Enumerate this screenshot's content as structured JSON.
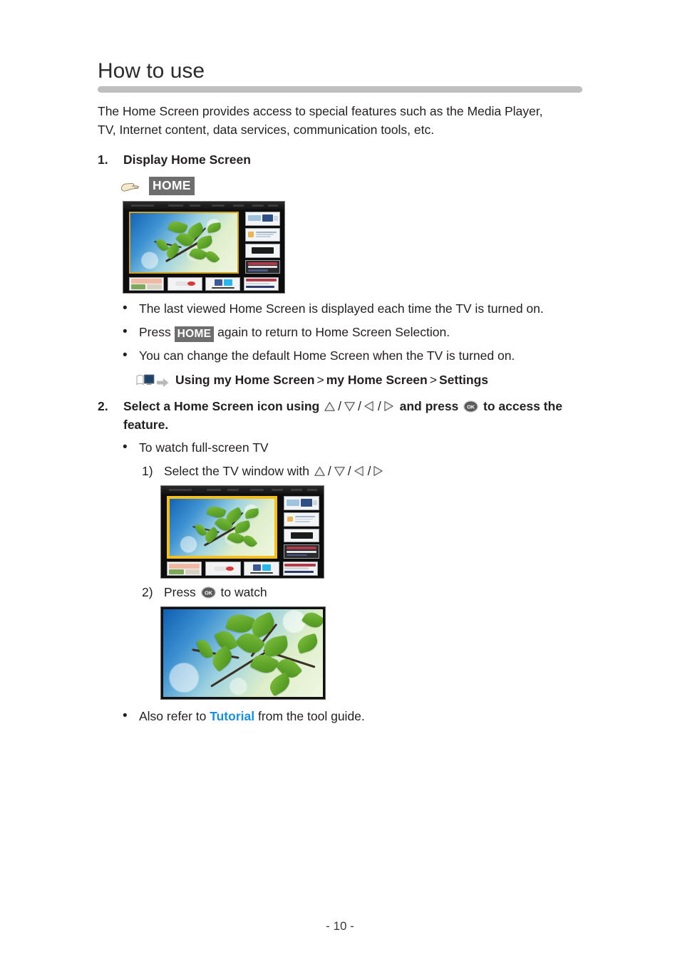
{
  "document": {
    "title": "How to use",
    "page_number": "- 10 -"
  },
  "intro": "The Home Screen provides access to special features such as the Media Player, TV, Internet content, data services, communication tools, etc.",
  "steps": [
    {
      "number": "1.",
      "heading": "Display Home Screen",
      "key_label": "HOME",
      "hand_icon": "pointing-hand-icon",
      "image_caption": "home-screen-tv-thumbnail",
      "bullets": [
        {
          "before": "The last viewed Home Screen is displayed each time the TV is turned on.",
          "key": "",
          "after": ""
        },
        {
          "before": "Press ",
          "key": "HOME",
          "after": " again to return to Home Screen Selection."
        },
        {
          "before": "You can change the default Home Screen when the TV is turned on.",
          "key": "",
          "after": ""
        }
      ],
      "path": {
        "book_icon": "manual-book-icon",
        "arrow_icon": "arrow-right-icon",
        "parts": [
          "Using my Home Screen",
          "my Home Screen",
          "Settings"
        ],
        "separator": ">"
      }
    },
    {
      "number": "2.",
      "heading_part1": "Select a Home Screen icon using",
      "heading_part2": "and press",
      "heading_part3": "to access the feature.",
      "arrow_icons": [
        "triangle-up-icon",
        "triangle-down-icon",
        "triangle-left-icon",
        "triangle-right-icon"
      ],
      "ok_icon": "ok-button-icon",
      "bullet": "To watch full-screen TV",
      "substeps": [
        {
          "number": "1)",
          "text_before": "Select the TV window with",
          "text_after": "",
          "image_caption": "home-screen-tv-selected-thumbnail"
        },
        {
          "number": "2)",
          "text_before": "Press",
          "text_after": "to watch",
          "image_caption": "full-screen-tv-thumbnail"
        }
      ],
      "final_bullet": {
        "before": "Also refer to ",
        "link": "Tutorial",
        "after": " from the tool guide."
      }
    }
  ],
  "colors": {
    "key_background": "#6e6e6e",
    "rule": "#bfbfbf",
    "link": "#1a8fd6",
    "selection_border": "#f6bf1a"
  }
}
